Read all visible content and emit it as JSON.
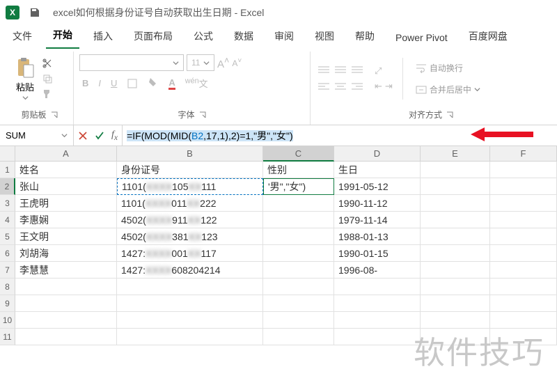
{
  "titlebar": {
    "title": "excel如何根据身份证号自动获取出生日期 - Excel",
    "app_badge": "X"
  },
  "tabs": [
    "文件",
    "开始",
    "插入",
    "页面布局",
    "公式",
    "数据",
    "审阅",
    "视图",
    "帮助",
    "Power Pivot",
    "百度网盘"
  ],
  "active_tab": 1,
  "ribbon": {
    "clipboard": {
      "paste": "粘贴",
      "label": "剪贴板"
    },
    "font": {
      "size": "11",
      "bold": "B",
      "italic": "I",
      "underline": "U",
      "label": "字体"
    },
    "align": {
      "wrap": "自动换行",
      "merge": "合并后居中",
      "label": "对齐方式"
    }
  },
  "namebox": "SUM",
  "formula": {
    "prefix": "=IF(",
    "fn1": "MOD",
    "fn2": "MID",
    "ref": "B2",
    "mid_args": ",17,1)",
    "mod_close": ",2)",
    "tail": "=1,\"男\",\"女\")"
  },
  "columns": [
    "A",
    "B",
    "C",
    "D",
    "E",
    "F"
  ],
  "active_col": 2,
  "active_row": 1,
  "row_count": 11,
  "header_row": {
    "A": "姓名",
    "B": "身份证号",
    "C": "性别",
    "D": "生日"
  },
  "rows": [
    {
      "A": "张山",
      "B_pre": "1101(",
      "B_mid": "105",
      "B_post": "111",
      "C": "'男\",\"女\")",
      "D": "1991-05-12"
    },
    {
      "A": "王虎明",
      "B_pre": "1101(",
      "B_mid": "011",
      "B_post": "222",
      "C": "",
      "D": "1990-11-12"
    },
    {
      "A": "李惠娴",
      "B_pre": "4502(",
      "B_mid": "911",
      "B_post": "122",
      "C": "",
      "D": "1979-11-14"
    },
    {
      "A": "王文明",
      "B_pre": "4502(",
      "B_mid": "381",
      "B_post": "123",
      "C": "",
      "D": "1988-01-13"
    },
    {
      "A": "刘胡海",
      "B_pre": "1427:",
      "B_mid": "001",
      "B_post": "117",
      "C": "",
      "D": "1990-01-15"
    },
    {
      "A": "李慧慧",
      "B_pre": "1427:",
      "B_mid": "608204214",
      "B_post": "",
      "C": "",
      "D": "1996-08-"
    }
  ],
  "watermark": "软件技巧"
}
